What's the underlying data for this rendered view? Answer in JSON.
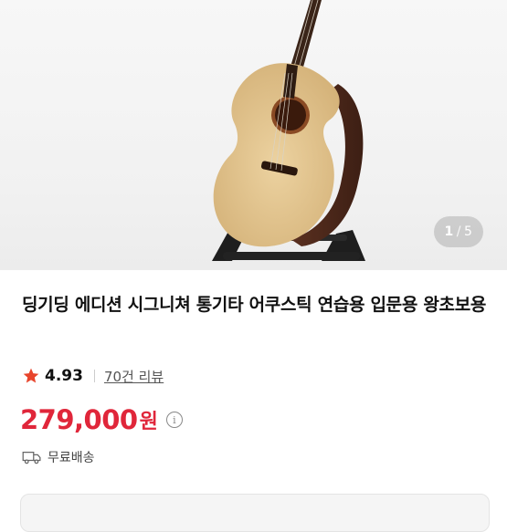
{
  "gallery": {
    "current": "1",
    "separator": "/",
    "total": "5",
    "image_alt": "acoustic guitar on stand"
  },
  "product": {
    "title": "딩기딩 에디션 시그니쳐 통기타 어쿠스틱 연습용 입문용 왕초보용",
    "rating": "4.93",
    "reviews": "70건 리뷰",
    "price": "279,000",
    "currency": "원",
    "shipping": "무료배송"
  },
  "icons": {
    "star": "star-icon",
    "info": "info-icon",
    "truck": "truck-icon"
  },
  "colors": {
    "price": "#e0263a",
    "star": "#e8452c"
  }
}
